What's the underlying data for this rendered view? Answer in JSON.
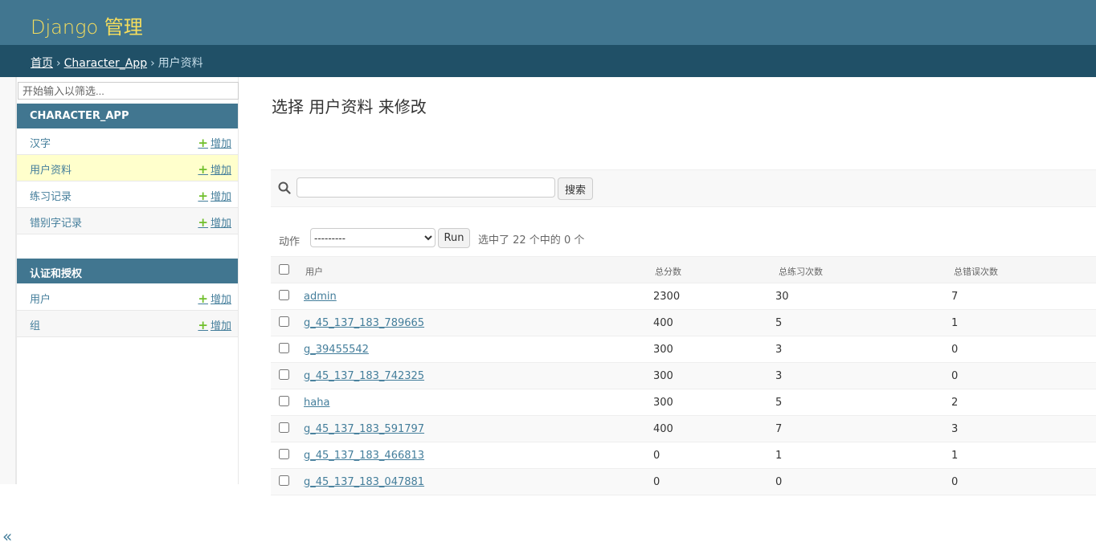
{
  "header": {
    "brand": "Django 管理"
  },
  "breadcrumbs": [
    "首页",
    "Character_App",
    "用户资料"
  ],
  "sidebar": {
    "filter_placeholder": "开始输入以筛选...",
    "modules": [
      {
        "caption": "CHARACTER_APP",
        "items": [
          {
            "label": "汉字",
            "add": "增加"
          },
          {
            "label": "用户资料",
            "add": "增加",
            "selected": true
          },
          {
            "label": "练习记录",
            "add": "增加"
          },
          {
            "label": "错别字记录",
            "add": "增加"
          }
        ]
      },
      {
        "caption": "认证和授权",
        "items": [
          {
            "label": "用户",
            "add": "增加"
          },
          {
            "label": "组",
            "add": "增加"
          }
        ]
      }
    ],
    "toggle": "«"
  },
  "main": {
    "title": "选择 用户资料 来修改",
    "search": {
      "value": "",
      "button": "搜索"
    },
    "actions": {
      "label": "动作",
      "selected": "---------",
      "run": "Run",
      "counter": "选中了 22 个中的 0 个"
    },
    "table": {
      "headers": [
        "用户",
        "总分数",
        "总练习次数",
        "总错误次数"
      ],
      "rows": [
        [
          "admin",
          "2300",
          "30",
          "7"
        ],
        [
          "g_45_137_183_789665",
          "400",
          "5",
          "1"
        ],
        [
          "g_39455542",
          "300",
          "3",
          "0"
        ],
        [
          "g_45_137_183_742325",
          "300",
          "3",
          "0"
        ],
        [
          "haha",
          "300",
          "5",
          "2"
        ],
        [
          "g_45_137_183_591797",
          "400",
          "7",
          "3"
        ],
        [
          "g_45_137_183_466813",
          "0",
          "1",
          "1"
        ],
        [
          "g_45_137_183_047881",
          "0",
          "0",
          "0"
        ]
      ]
    }
  },
  "colors": {
    "header_bg": "#417690",
    "breadcrumb_bg": "#205067",
    "brand": "#f5dd5d",
    "link": "#447e9b",
    "add_plus": "#70bf2b",
    "selected_row": "#ffffcc"
  }
}
